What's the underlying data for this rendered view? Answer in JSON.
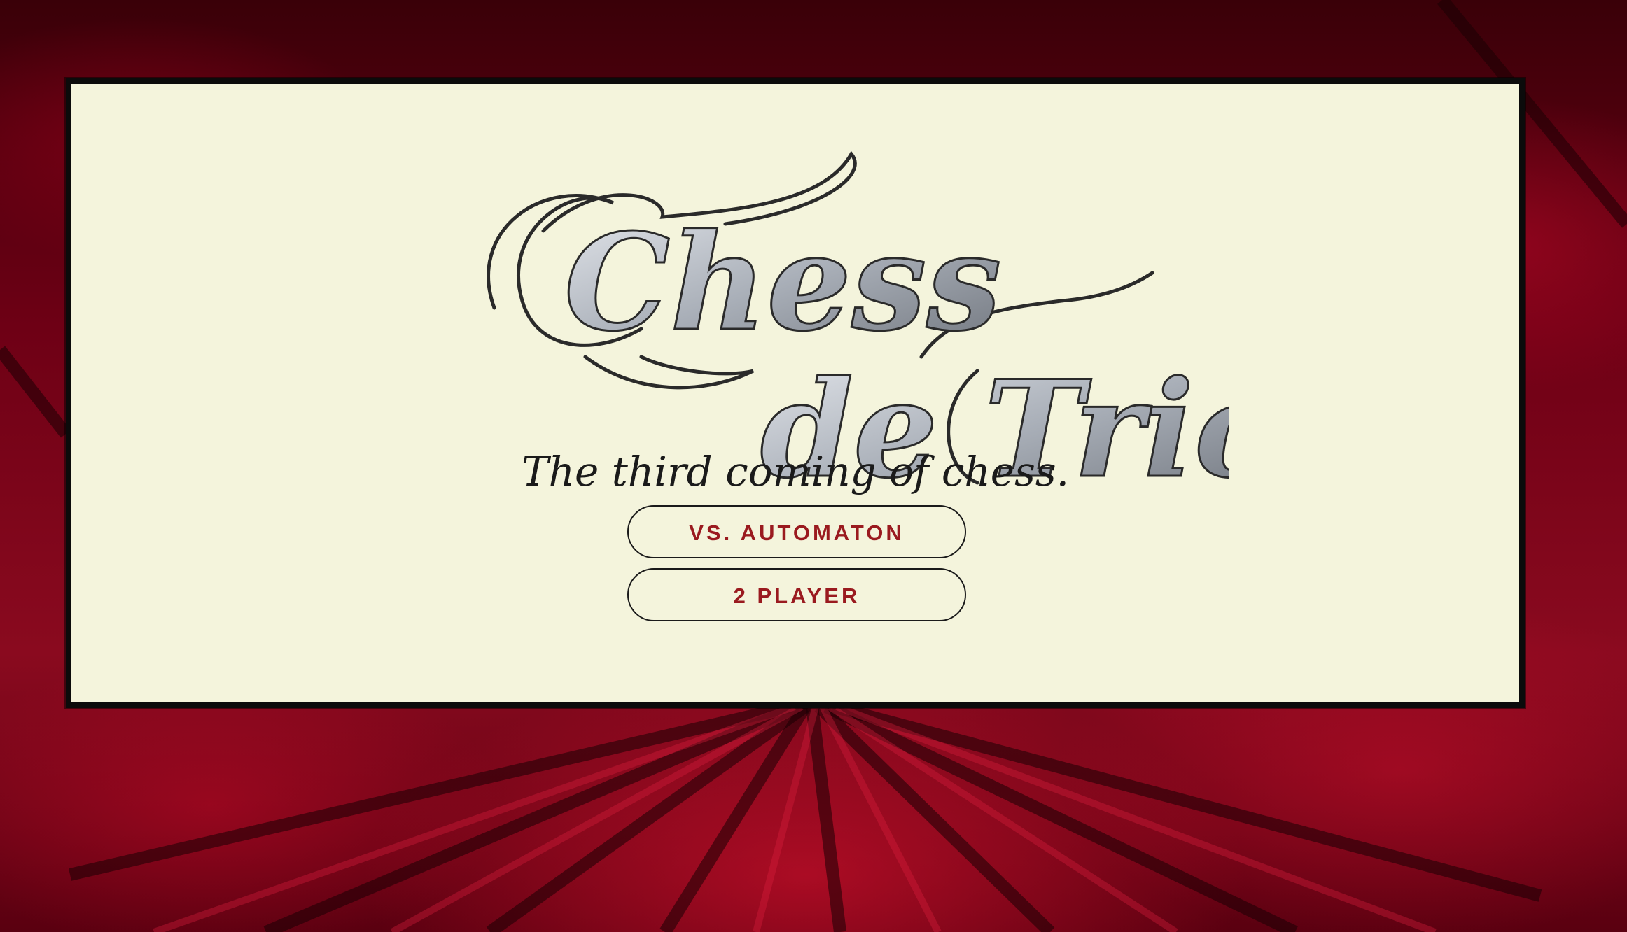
{
  "background": {
    "texture": "red-velvet",
    "colors": [
      "#5a0010",
      "#8a0a1f",
      "#c8102e"
    ]
  },
  "panel": {
    "background_color": "#f4f4dc",
    "border_color": "#0b0b0b"
  },
  "logo": {
    "line1": "Chess",
    "line2": "de Trio",
    "colors": [
      "#2a2a2a",
      "#a9afb8"
    ]
  },
  "tagline": "The third coming of chess.",
  "menu": {
    "vs_automaton_label": "VS. AUTOMATON",
    "two_player_label": "2 PLAYER",
    "label_color": "#9a1a1f"
  }
}
